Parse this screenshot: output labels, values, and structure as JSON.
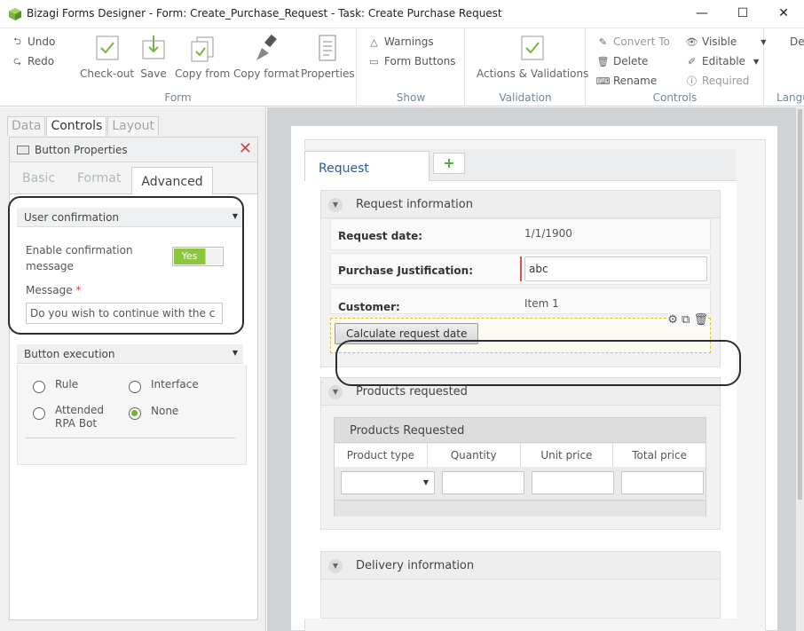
{
  "window": {
    "title": "Bizagi Forms Designer  - Form: Create_Purchase_Request - Task:  Create Purchase Request",
    "minimize": "—",
    "maximize": "☐",
    "close": "✕"
  },
  "ribbon": {
    "undo": "Undo",
    "redo": "Redo",
    "checkout": "Check-out",
    "save": "Save",
    "copy_from": "Copy from",
    "copy_format": "Copy format",
    "properties": "Properties",
    "form_group": "Form",
    "warnings": "Warnings",
    "form_buttons": "Form Buttons",
    "show_group": "Show",
    "actions_validations": "Actions & Validations",
    "validation_group": "Validation",
    "convert_to": "Convert To",
    "delete": "Delete",
    "rename": "Rename",
    "visible": "Visible",
    "editable": "Editable",
    "required": "Required",
    "controls_group": "Controls",
    "de_partial": "De",
    "lang_partial": "Langu"
  },
  "left_panel": {
    "tabs": [
      "Data",
      "Controls",
      "Layout"
    ],
    "props_title": "Button Properties",
    "sub_tabs": [
      "Basic",
      "Format",
      "Advanced"
    ],
    "user_confirmation": "User confirmation",
    "enable_confirmation_label": "Enable confirmation message",
    "toggle_value": "Yes",
    "message_label": "Message",
    "required_mark": "*",
    "message_value": "Do you wish to continue with the c",
    "button_execution": "Button execution",
    "radios": [
      {
        "label": "Rule",
        "checked": false
      },
      {
        "label": "Interface",
        "checked": false
      },
      {
        "label": "Attended RPA Bot",
        "checked": false
      },
      {
        "label": "None",
        "checked": true
      }
    ]
  },
  "form": {
    "tab_label": "Request",
    "plus": "+",
    "groups": {
      "request_info": "Request information",
      "products_requested": "Products requested",
      "delivery_info": "Delivery information"
    },
    "rows": {
      "request_date_label": "Request date:",
      "request_date_value": "1/1/1900",
      "justification_label": "Purchase Justification:",
      "justification_value": "abc",
      "customer_label": "Customer:",
      "customer_value": "Item 1"
    },
    "calc_button": "Calculate request date",
    "grid": {
      "title": "Products Requested",
      "columns": [
        "Product type",
        "Quantity",
        "Unit price",
        "Total price"
      ]
    }
  },
  "colors": {
    "accent_green": "#8cc63f",
    "tab_blue": "#2a5aa5",
    "group_label": "#6b8a9b"
  }
}
